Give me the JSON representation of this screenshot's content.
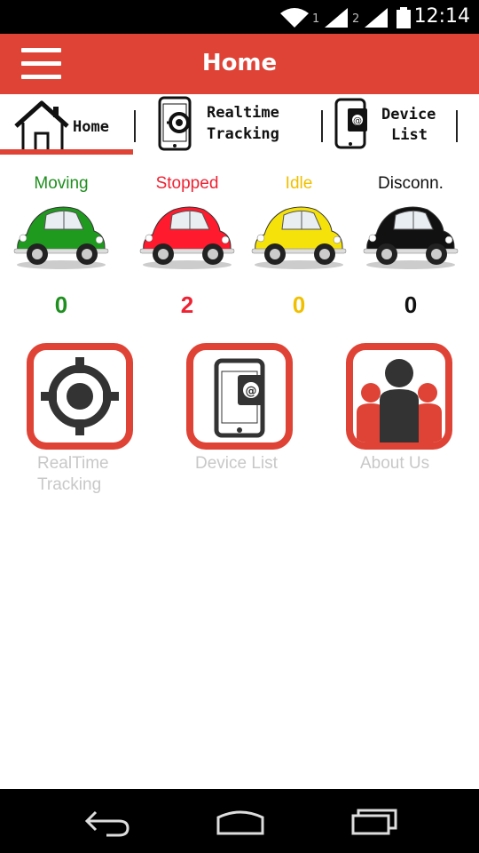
{
  "status_bar": {
    "time": "12:14",
    "sim1": "1",
    "sim2": "2"
  },
  "app_bar": {
    "title": "Home",
    "menu_icon": "hamburger-menu-icon"
  },
  "tabs": [
    {
      "label": "Home",
      "icon": "house-icon",
      "selected": true
    },
    {
      "label_line1": "Realtime",
      "label_line2": "Tracking",
      "icon": "phone-tracking-icon"
    },
    {
      "label_line1": "Device",
      "label_line2": "List",
      "icon": "phone-contacts-icon"
    }
  ],
  "vehicle_status": [
    {
      "label": "Moving",
      "count": "0",
      "color": "#1f8f1f",
      "car_color": "#1f9a1f"
    },
    {
      "label": "Stopped",
      "count": "2",
      "color": "#ee2233",
      "car_color": "#ff1a2e"
    },
    {
      "label": "Idle",
      "count": "0",
      "color": "#f0c000",
      "car_color": "#f5e20a"
    },
    {
      "label": "Disconn.",
      "count": "0",
      "color": "#111111",
      "car_color": "#111111"
    }
  ],
  "shortcuts": [
    {
      "line1": "RealTime",
      "line2": "Tracking",
      "icon": "crosshair-target-icon"
    },
    {
      "line1": "Device List",
      "line2": "",
      "icon": "phone-contacts-icon"
    },
    {
      "line1": "About Us",
      "line2": "",
      "icon": "people-group-icon"
    }
  ],
  "colors": {
    "accent": "#df4336",
    "tile_label": "#c8c8c8"
  }
}
